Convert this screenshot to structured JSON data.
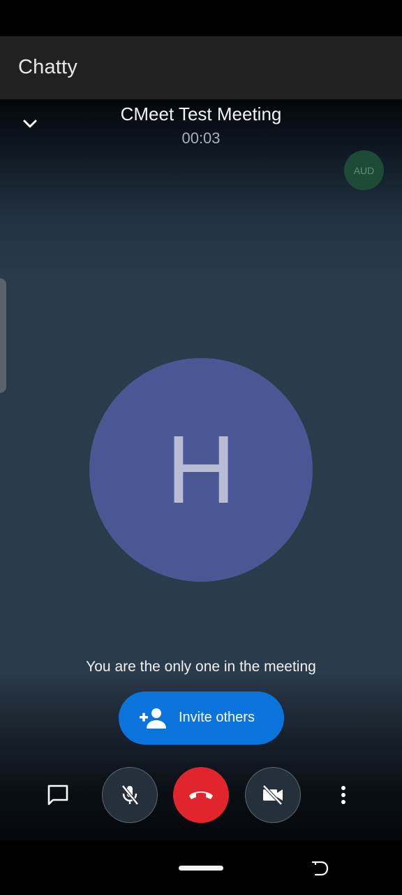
{
  "app": {
    "title": "Chatty"
  },
  "meeting": {
    "title": "CMeet Test Meeting",
    "timer": "00:03",
    "audio_badge": "AUD",
    "avatar_letter": "H",
    "avatar_color": "#4b5794",
    "status_message": "You are the only one in the meeting",
    "invite_label": "Invite others",
    "invite_color": "#0b74dc"
  },
  "controls": {
    "chat": {
      "icon": "chat-bubble-icon"
    },
    "mic": {
      "icon": "mic-off-icon",
      "state": "muted"
    },
    "hangup": {
      "icon": "call-end-icon",
      "color": "#e0262c"
    },
    "video": {
      "icon": "videocam-off-icon",
      "state": "off"
    },
    "more": {
      "icon": "more-vertical-icon"
    }
  },
  "nav": {
    "home": "home-pill",
    "rotate": "rotate-icon"
  }
}
